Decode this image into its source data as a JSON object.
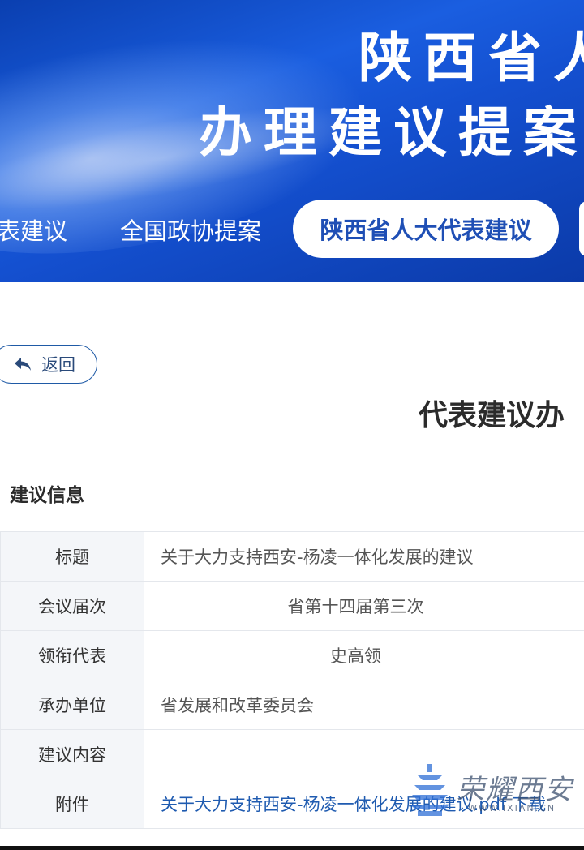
{
  "banner": {
    "title_line1": "陕西省人",
    "title_line2": "办理建议提案",
    "colors": {
      "primary": "#1450d0",
      "active_tab_text": "#1f4fb5"
    }
  },
  "nav": {
    "tabs": [
      {
        "label": "代表建议",
        "visible_label": "表建议"
      },
      {
        "label": "全国政协提案"
      },
      {
        "label": "陕西省人大代表建议",
        "active": true
      }
    ]
  },
  "back_button": {
    "label": "返回",
    "icon": "reply-arrow-icon"
  },
  "page_heading": "代表建议办",
  "section": {
    "title": "建议信息"
  },
  "info_rows": [
    {
      "label": "标题",
      "value": "关于大力支持西安-杨凌一体化发展的建议"
    },
    {
      "label": "会议届次",
      "value": "省第十四届第三次"
    },
    {
      "label": "领衔代表",
      "value": "史高领"
    },
    {
      "label": "承办单位",
      "value": "省发展和改革委员会"
    },
    {
      "label": "建议内容",
      "value": ""
    },
    {
      "label": "附件",
      "value": "关于大力支持西安-杨凌一体化发展的建议.pdf 下载"
    }
  ],
  "watermark": {
    "text": "荣耀西安",
    "subtext": "WWW.IXIAN.CN"
  }
}
